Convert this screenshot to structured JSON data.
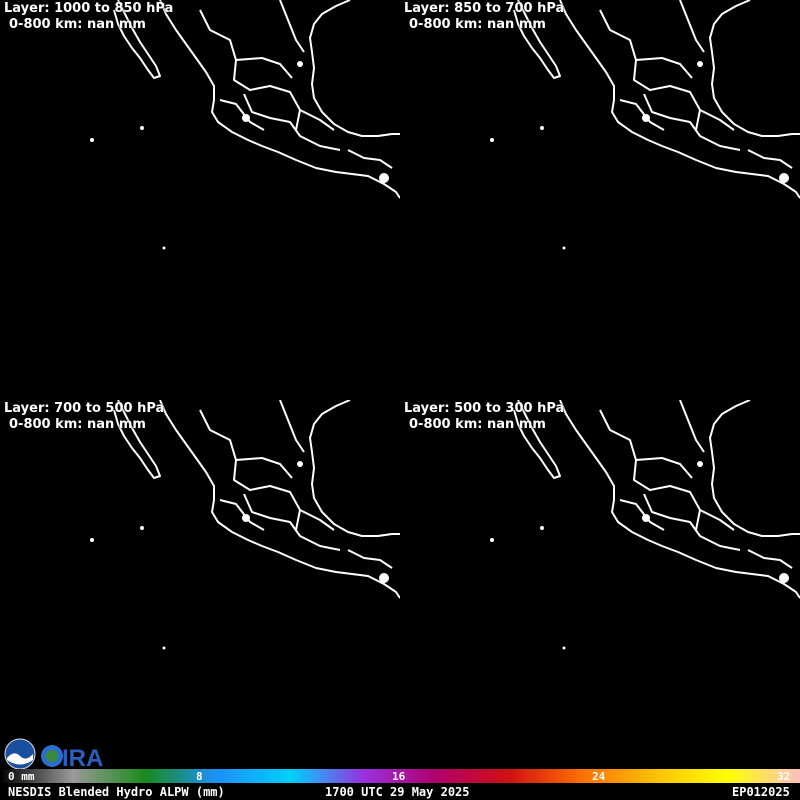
{
  "panels": [
    {
      "layer": "Layer: 1000 to 850 hPa",
      "sub": "0-800 km: nan mm"
    },
    {
      "layer": "Layer: 850 to 700 hPa",
      "sub": "0-800 km: nan mm"
    },
    {
      "layer": "Layer: 700 to 500 hPa",
      "sub": "0-800 km: nan mm"
    },
    {
      "layer": "Layer: 500 to 300 hPa",
      "sub": "0-800 km: nan mm"
    }
  ],
  "colorbar": {
    "ticks": [
      "0 mm",
      "8",
      "16",
      "24",
      "32"
    ],
    "colors": [
      "#000000",
      "#9a9a9a",
      "#1a8a1a",
      "#1e90ff",
      "#00d0ff",
      "#9a30e0",
      "#b0006a",
      "#d01010",
      "#ff7000",
      "#ffc000",
      "#ffff00",
      "#ffc0c0"
    ]
  },
  "footer": {
    "product": "NESDIS Blended Hydro ALPW (mm)",
    "time": "1700 UTC 29 May 2025",
    "storm_id": "EP012025"
  },
  "logos": {
    "noaa": "NOAA",
    "cira": "CIRA"
  }
}
